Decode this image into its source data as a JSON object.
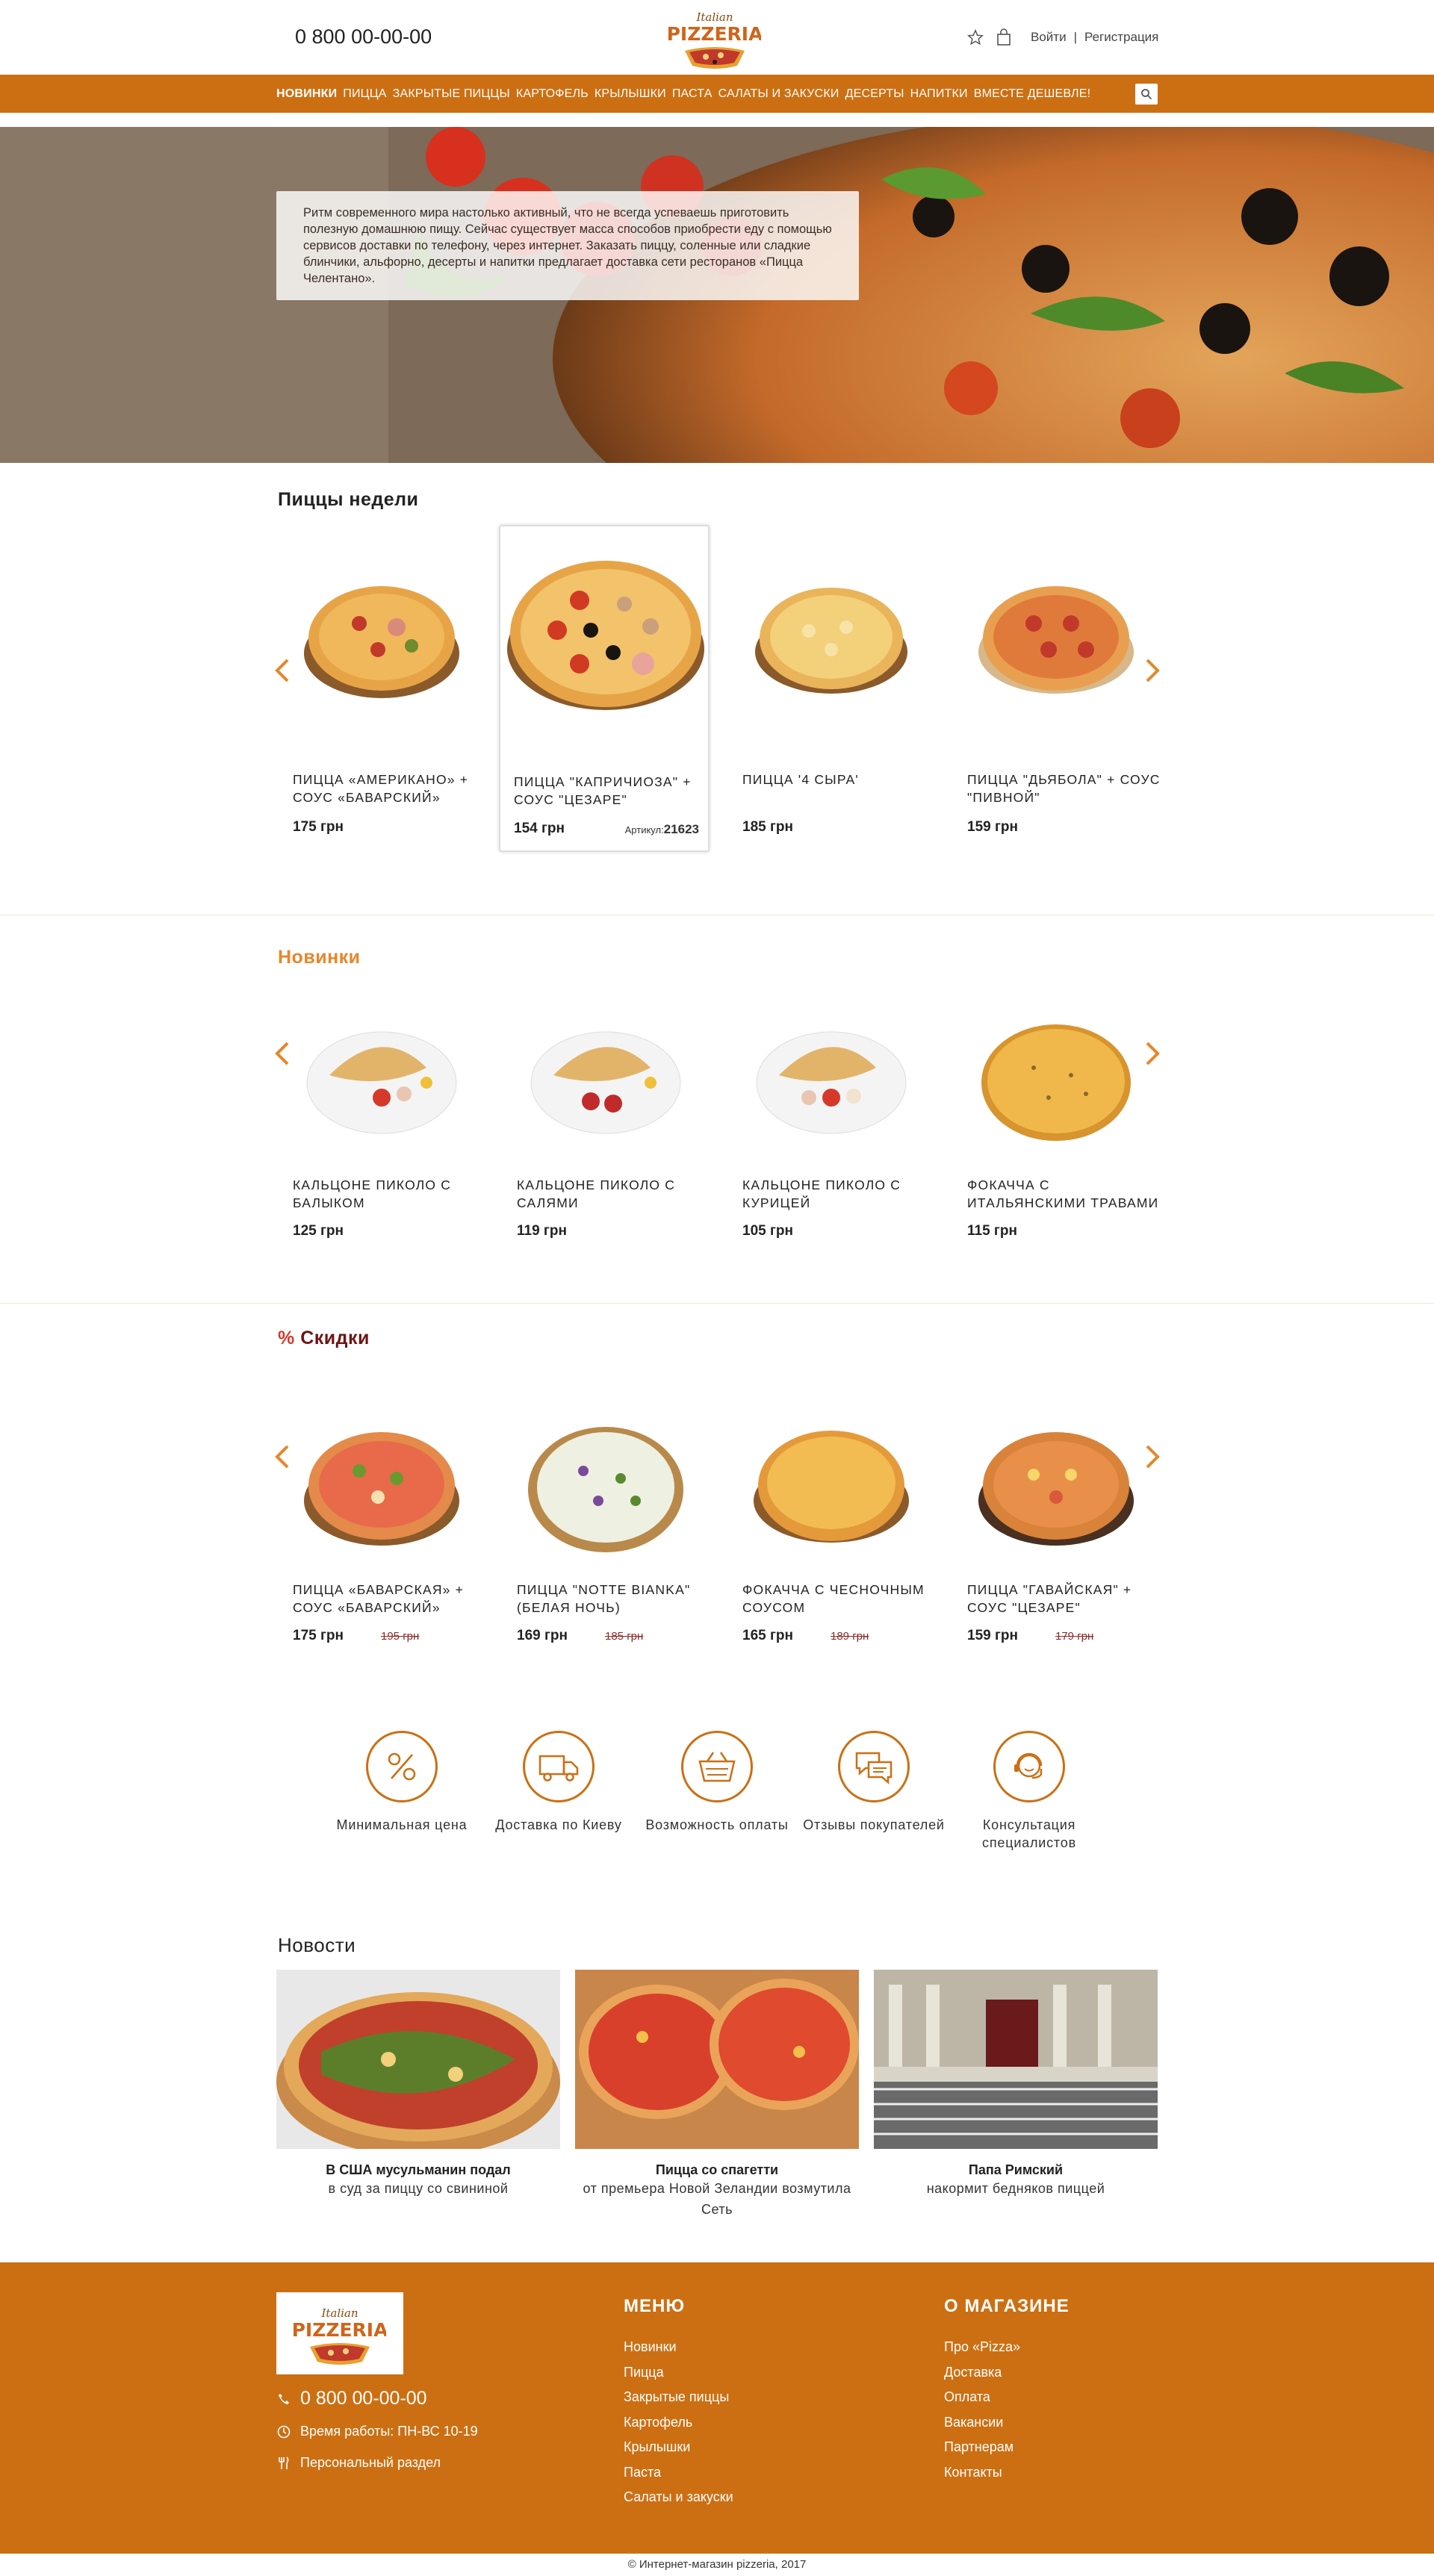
{
  "header": {
    "phone": "0 800 00-00-00",
    "logo_top": "Italian",
    "logo_main": "PIZZERIA",
    "login": "Войти",
    "separator": "|",
    "register": "Регистрация",
    "icons": [
      "star-icon",
      "bag-icon"
    ]
  },
  "nav": {
    "items": [
      "НОВИНКИ",
      "ПИЦЦА",
      "ЗАКРЫТЫЕ ПИЦЦЫ",
      "КАРТОФЕЛЬ",
      "КРЫЛЫШКИ",
      "ПАСТА",
      "САЛАТЫ И ЗАКУСКИ",
      "ДЕСЕРТЫ",
      "НАПИТКИ",
      "ВМЕСТЕ ДЕШЕВЛЕ!"
    ],
    "active_index": 0,
    "bg_color": "#cc6f13"
  },
  "hero": {
    "text": "Ритм современного мира настолько активный, что не всегда успеваешь приготовить полезную домашнюю пищу. Сейчас существует масса способов приобрести еду с помощью сервисов доставки по телефону, через интернет. Заказать пиццу, соленные или сладкие блинчики, альфорно, десерты и напитки предлагает доставка сети ресторанов «Пицца Челентано»."
  },
  "weekly": {
    "title": "Пиццы недели",
    "items": [
      {
        "name": "ПИЦЦА «АМЕРИКАНО» + СОУС «БАВАРСКИЙ»",
        "price": "175 грн"
      },
      {
        "name": "ПИЦЦА \"КАПРИЧИОЗА\" + СОУС \"ЦЕЗАРЕ\"",
        "price": "154 грн",
        "article_label": "Артикул:",
        "article": "21623"
      },
      {
        "name": "ПИЦЦА '4 СЫРА'",
        "price": "185 грн"
      },
      {
        "name": "ПИЦЦА \"ДЬЯБОЛА\" + СОУС \"ПИВНОЙ\"",
        "price": "159 грн"
      }
    ]
  },
  "new": {
    "title": "Новинки",
    "items": [
      {
        "name": "КАЛЬЦОНЕ ПИКОЛО С БАЛЫКОМ",
        "price": "125 грн"
      },
      {
        "name": "КАЛЬЦОНЕ ПИКОЛО С САЛЯМИ",
        "price": "119 грн"
      },
      {
        "name": "КАЛЬЦОНЕ ПИКОЛО С КУРИЦЕЙ",
        "price": "105 грн"
      },
      {
        "name": "ФОКАЧЧА С ИТАЛЬЯНСКИМИ ТРАВАМИ",
        "price": "115 грн"
      }
    ]
  },
  "sale": {
    "title_mark": "%",
    "title": "Скидки",
    "items": [
      {
        "name": "ПИЦЦА «БАВАРСКАЯ» + СОУС «БАВАРСКИЙ»",
        "price": "175 грн",
        "old_price": "195 грн"
      },
      {
        "name": "ПИЦЦА \"NOTTE BIANKA\" (БЕЛАЯ НОЧЬ)",
        "price": "169 грн",
        "old_price": "185 грн"
      },
      {
        "name": "ФОКАЧЧА С ЧЕСНОЧНЫМ СОУСОМ",
        "price": "165 грн",
        "old_price": "189 грн"
      },
      {
        "name": "ПИЦЦА \"ГАВАЙСКАЯ\" + СОУС \"ЦЕЗАРЕ\"",
        "price": "159 грн",
        "old_price": "179 грн"
      }
    ]
  },
  "features": [
    {
      "label": "Минимальная цена",
      "icon": "percent-icon"
    },
    {
      "label": "Доставка по Киеву",
      "icon": "truck-icon"
    },
    {
      "label": "Возможность оплаты",
      "icon": "basket-icon"
    },
    {
      "label": "Отзывы покупателей",
      "icon": "chat-icon"
    },
    {
      "label": "Консультация специалистов",
      "icon": "support-icon"
    }
  ],
  "news": {
    "title": "Новости",
    "items": [
      {
        "title": "В США мусульманин подал",
        "subtitle": "в суд за пиццу со свининой"
      },
      {
        "title": "Пицца со спагетти",
        "subtitle": "от премьера Новой Зеландии возмутила Сеть"
      },
      {
        "title": "Папа Римский",
        "subtitle": "накормит бедняков пиццей"
      }
    ]
  },
  "footer": {
    "phone": "0 800 00-00-00",
    "hours": "Время работы: ПН-ВС 10-19",
    "personal": "Персональный раздел",
    "menu_title": "МЕНЮ",
    "menu_items": [
      "Новинки",
      "Пицца",
      "Закрытые пиццы",
      "Картофель",
      "Крылышки",
      "Паста",
      "Салаты и закуски"
    ],
    "about_title": "О МАГАЗИНЕ",
    "about_items": [
      "Про «Pizza»",
      "Доставка",
      "Оплата",
      "Вакансии",
      "Партнерам",
      "Контакты"
    ],
    "copyright": "© Интернет-магазин pizzeria, 2017"
  },
  "colors": {
    "accent": "#cc6f13",
    "new_title": "#e8862a",
    "sale_title": "#6e1414",
    "sale_mark": "#d33b2c"
  }
}
